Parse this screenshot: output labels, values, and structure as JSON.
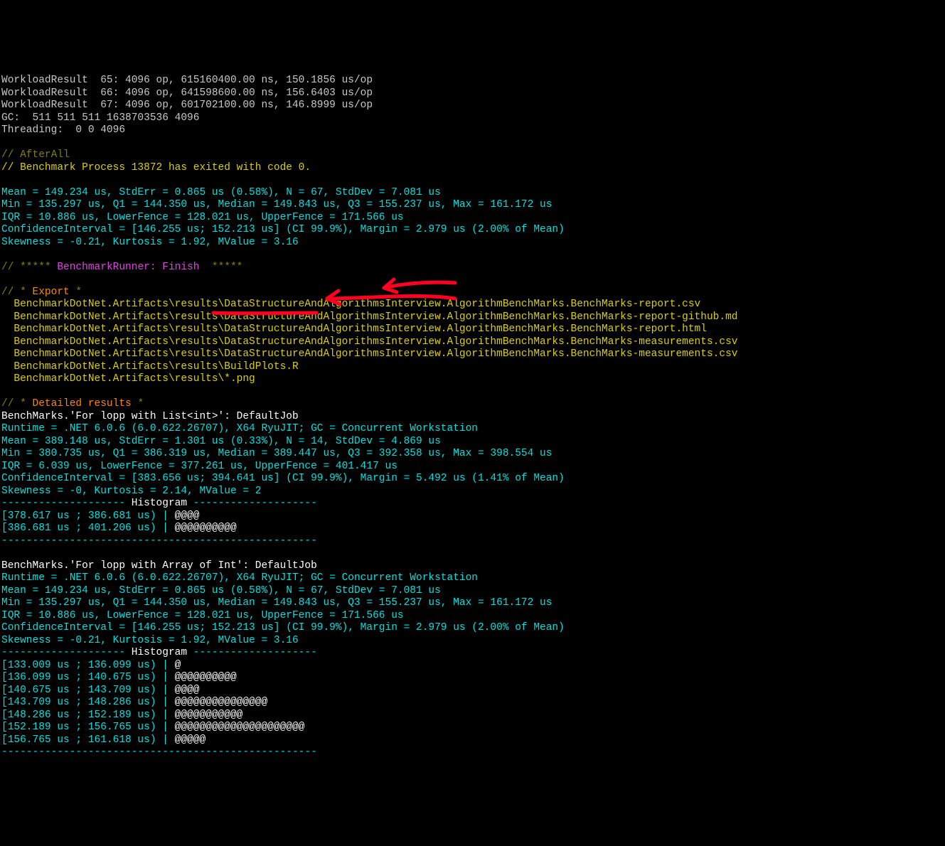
{
  "head": {
    "wr1": "WorkloadResult  65: 4096 op, 615160400.00 ns, 150.1856 us/op",
    "wr2": "WorkloadResult  66: 4096 op, 641598600.00 ns, 156.6403 us/op",
    "wr3": "WorkloadResult  67: 4096 op, 601702100.00 ns, 146.8999 us/op",
    "gc": "GC:  511 511 511 1638703536 4096",
    "thr": "Threading:  0 0 4096"
  },
  "afterall": {
    "label": "// AfterAll",
    "exit": "// Benchmark Process 13872 has exited with code 0."
  },
  "stats_a": {
    "mean": "Mean = 149.234 us, StdErr = 0.865 us (0.58%), N = 67, StdDev = 7.081 us",
    "min": "Min = 135.297 us, Q1 = 144.350 us, Median = 149.843 us, Q3 = 155.237 us, Max = 161.172 us",
    "iqr": "IQR = 10.886 us, LowerFence = 128.021 us, UpperFence = 171.566 us",
    "ci": "ConfidenceInterval = [146.255 us; 152.213 us] (CI 99.9%), Margin = 2.979 us (2.00% of Mean)",
    "skew": "Skewness = -0.21, Kurtosis = 1.92, MValue = 3.16"
  },
  "runner": {
    "pre": "// ***** ",
    "name": "BenchmarkRunner: Finish",
    "post": "  *****"
  },
  "export": {
    "header_pre": "// * ",
    "header": "Export",
    "header_post": " *",
    "f1": "  BenchmarkDotNet.Artifacts\\results\\DataStructureAndAlgorithmsInterview.AlgorithmBenchMarks.BenchMarks-report.csv",
    "f2": "  BenchmarkDotNet.Artifacts\\results\\DataStructureAndAlgorithmsInterview.AlgorithmBenchMarks.BenchMarks-report-github.md",
    "f3": "  BenchmarkDotNet.Artifacts\\results\\DataStructureAndAlgorithmsInterview.AlgorithmBenchMarks.BenchMarks-report.html",
    "f4": "  BenchmarkDotNet.Artifacts\\results\\DataStructureAndAlgorithmsInterview.AlgorithmBenchMarks.BenchMarks-measurements.csv",
    "f5": "  BenchmarkDotNet.Artifacts\\results\\DataStructureAndAlgorithmsInterview.AlgorithmBenchMarks.BenchMarks-measurements.csv",
    "f6": "  BenchmarkDotNet.Artifacts\\results\\BuildPlots.R",
    "f7": "  BenchmarkDotNet.Artifacts\\results\\*.png"
  },
  "detailed": {
    "header_pre": "// * ",
    "header": "Detailed results",
    "header_post": " *"
  },
  "bench_list": {
    "title": "BenchMarks.'For lopp with List<int>': DefaultJob",
    "runtime": "Runtime = .NET 6.0.6 (6.0.622.26707), X64 RyuJIT; GC = Concurrent Workstation",
    "mean": "Mean = 389.148 us, StdErr = 1.301 us (0.33%), N = 14, StdDev = 4.869 us",
    "min": "Min = 380.735 us, Q1 = 386.319 us, Median = 389.447 us, Q3 = 392.358 us, Max = 398.554 us",
    "iqr": "IQR = 6.039 us, LowerFence = 377.261 us, UpperFence = 401.417 us",
    "ci": "ConfidenceInterval = [383.656 us; 394.641 us] (CI 99.9%), Margin = 5.492 us (1.41% of Mean)",
    "skew": "Skewness = -0, Kurtosis = 2.14, MValue = 2",
    "hist_hdr_pre": "-------------------- ",
    "hist_hdr": "Histogram",
    "hist_hdr_post": " --------------------",
    "h1a": "[378.617 us ; 386.681 us) | ",
    "h1b": "@@@@",
    "h2a": "[386.681 us ; 401.206 us) | ",
    "h2b": "@@@@@@@@@@",
    "dash": "---------------------------------------------------"
  },
  "bench_arr": {
    "title": "BenchMarks.'For lopp with Array of Int': DefaultJob",
    "runtime": "Runtime = .NET 6.0.6 (6.0.622.26707), X64 RyuJIT; GC = Concurrent Workstation",
    "mean": "Mean = 149.234 us, StdErr = 0.865 us (0.58%), N = 67, StdDev = 7.081 us",
    "min": "Min = 135.297 us, Q1 = 144.350 us, Median = 149.843 us, Q3 = 155.237 us, Max = 161.172 us",
    "iqr": "IQR = 10.886 us, LowerFence = 128.021 us, UpperFence = 171.566 us",
    "ci": "ConfidenceInterval = [146.255 us; 152.213 us] (CI 99.9%), Margin = 2.979 us (2.00% of Mean)",
    "skew": "Skewness = -0.21, Kurtosis = 1.92, MValue = 3.16",
    "hist_hdr_pre": "-------------------- ",
    "hist_hdr": "Histogram",
    "hist_hdr_post": " --------------------",
    "h1a": "[133.009 us ; 136.099 us) | ",
    "h1b": "@",
    "h2a": "[136.099 us ; 140.675 us) | ",
    "h2b": "@@@@@@@@@@",
    "h3a": "[140.675 us ; 143.709 us) | ",
    "h3b": "@@@@",
    "h4a": "[143.709 us ; 148.286 us) | ",
    "h4b": "@@@@@@@@@@@@@@@",
    "h5a": "[148.286 us ; 152.189 us) | ",
    "h5b": "@@@@@@@@@@@",
    "h6a": "[152.189 us ; 156.765 us) | ",
    "h6b": "@@@@@@@@@@@@@@@@@@@@@",
    "h7a": "[156.765 us ; 161.618 us) | ",
    "h7b": "@@@@@",
    "dash": "---------------------------------------------------"
  }
}
